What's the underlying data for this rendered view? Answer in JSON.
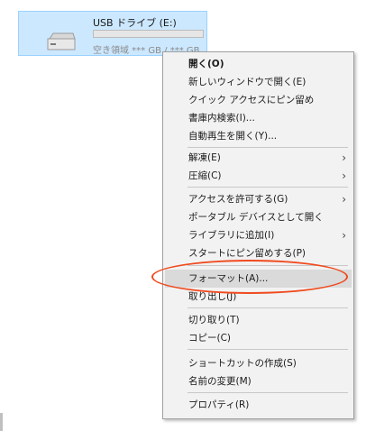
{
  "drive": {
    "name": "USB ドライブ (E:)",
    "free_space": "空き領域 *** GB / *** GB"
  },
  "menu": {
    "groups": [
      [
        {
          "label": "開く(O)",
          "bold": true
        },
        {
          "label": "新しいウィンドウで開く(E)"
        },
        {
          "label": "クイック アクセスにピン留め"
        },
        {
          "label": "書庫内検索(I)..."
        },
        {
          "label": "自動再生を開く(Y)..."
        }
      ],
      [
        {
          "label": "解凍(E)",
          "submenu": true
        },
        {
          "label": "圧縮(C)",
          "submenu": true
        }
      ],
      [
        {
          "label": "アクセスを許可する(G)",
          "submenu": true
        },
        {
          "label": "ポータブル デバイスとして開く"
        },
        {
          "label": "ライブラリに追加(I)",
          "submenu": true
        },
        {
          "label": "スタートにピン留めする(P)"
        }
      ],
      [
        {
          "label": "フォーマット(A)...",
          "highlighted": true
        },
        {
          "label": "取り出し(J)"
        }
      ],
      [
        {
          "label": "切り取り(T)"
        },
        {
          "label": "コピー(C)"
        }
      ],
      [
        {
          "label": "ショートカットの作成(S)"
        },
        {
          "label": "名前の変更(M)"
        }
      ],
      [
        {
          "label": "プロパティ(R)"
        }
      ]
    ]
  },
  "colors": {
    "selection_bg": "#cce8ff",
    "menu_bg": "#f2f2f2",
    "highlight_bg": "#dadada",
    "annotation_ellipse": "#f04a1e"
  }
}
